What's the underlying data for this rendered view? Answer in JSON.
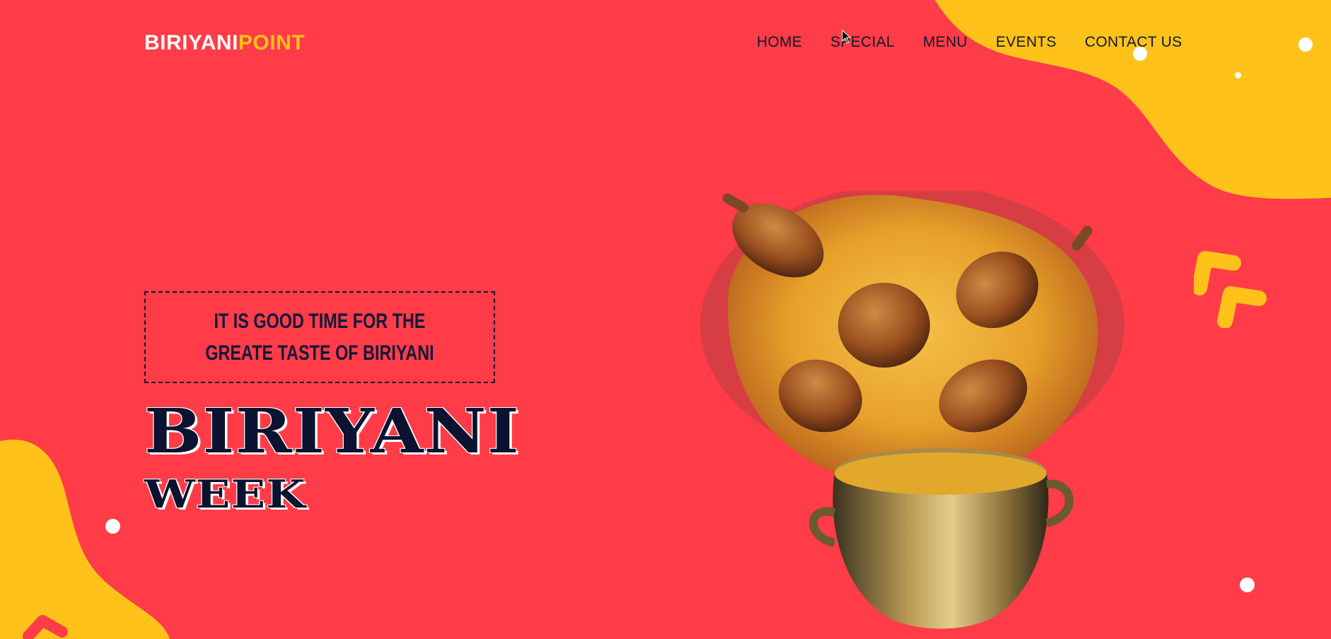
{
  "brand": {
    "part1": "BIRIYANI",
    "part2": "POINT"
  },
  "nav": {
    "items": [
      "HOME",
      "SPECIAL",
      "MENU",
      "EVENTS",
      "CONTACT US"
    ]
  },
  "hero": {
    "tagline": "IT IS GOOD TIME FOR THE GREATE TASTE OF BIRIYANI",
    "title_line1": "BIRIYANI",
    "title_line2": "WEEK"
  },
  "colors": {
    "background": "#ff3c48",
    "accent_yellow": "#ffc21a",
    "heading_navy": "#0c1330"
  },
  "icons": [
    "chevron-shape-icon",
    "biriyani-pot-image",
    "cursor-icon"
  ]
}
